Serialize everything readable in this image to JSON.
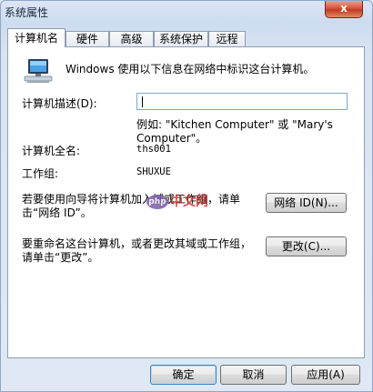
{
  "window": {
    "title": "系统属性",
    "close_glyph": "x"
  },
  "tabs": [
    {
      "label": "计算机名"
    },
    {
      "label": "硬件"
    },
    {
      "label": "高级"
    },
    {
      "label": "系统保护"
    },
    {
      "label": "远程"
    }
  ],
  "content": {
    "intro": "Windows 使用以下信息在网络中标识这台计算机。",
    "description_label": "计算机描述(D):",
    "description_value": "",
    "example_line1": "例如: \"Kitchen Computer\" 或 \"Mary's",
    "example_line2": "Computer\"。",
    "full_name_label": "计算机全名:",
    "full_name_value": "ths001",
    "workgroup_label": "工作组:",
    "workgroup_value": "SHUXUE",
    "network_text_line1": "若要使用向导将计算机加入域或工作组，请单",
    "network_text_line2": "击“网络 ID”。",
    "network_button": "网络 ID(N)...",
    "rename_text_line1": "要重命名这台计算机，或者更改其域或工作组，",
    "rename_text_line2": "请单击“更改”。",
    "change_button": "更改(C)..."
  },
  "footer": {
    "ok": "确定",
    "cancel": "取消",
    "apply": "应用(A)"
  },
  "watermark": {
    "badge": "php",
    "text": "中文网"
  }
}
